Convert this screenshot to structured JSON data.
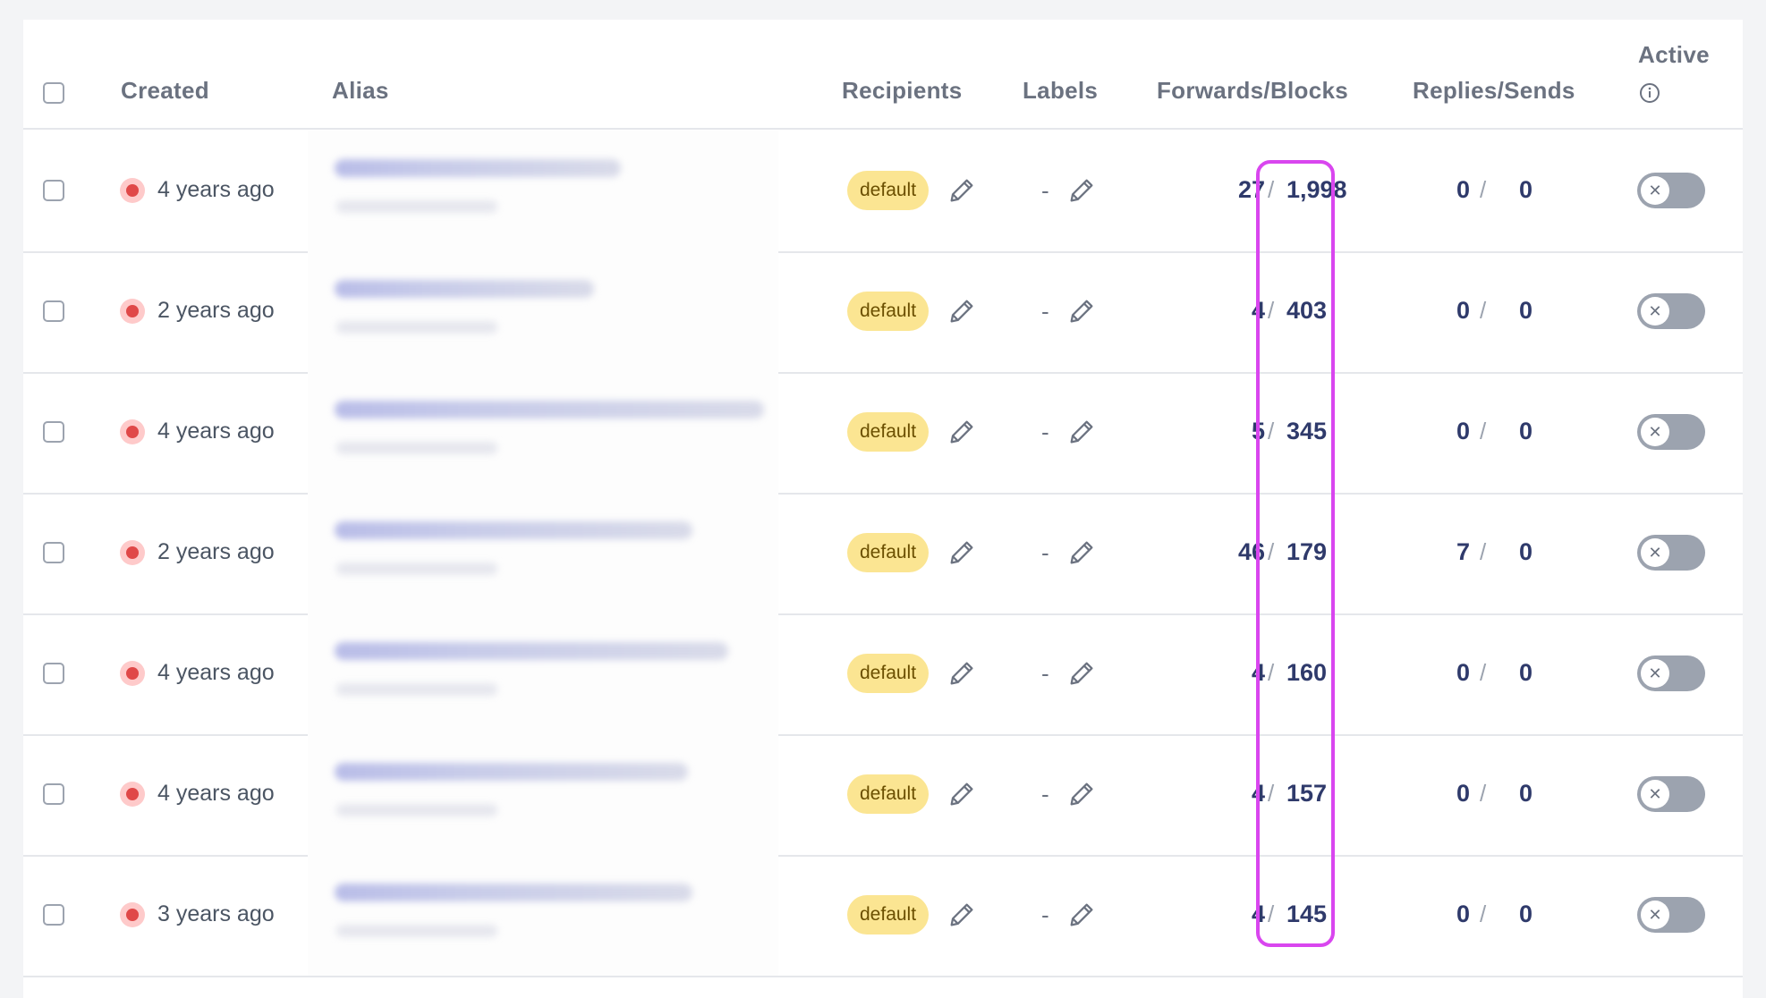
{
  "table": {
    "headers": {
      "created": "Created",
      "alias": "Alias",
      "recipients": "Recipients",
      "labels": "Labels",
      "forwards_blocks": "Forwards/Blocks",
      "replies_sends": "Replies/Sends",
      "active": "Active"
    },
    "rows": [
      {
        "created": "4 years ago",
        "recipient": "default",
        "labels": "-",
        "forwards": "27",
        "blocks": "1,998",
        "replies": "0",
        "sends": "0"
      },
      {
        "created": "2 years ago",
        "recipient": "default",
        "labels": "-",
        "forwards": "4",
        "blocks": "403",
        "replies": "0",
        "sends": "0"
      },
      {
        "created": "4 years ago",
        "recipient": "default",
        "labels": "-",
        "forwards": "5",
        "blocks": "345",
        "replies": "0",
        "sends": "0"
      },
      {
        "created": "2 years ago",
        "recipient": "default",
        "labels": "-",
        "forwards": "46",
        "blocks": "179",
        "replies": "7",
        "sends": "0"
      },
      {
        "created": "4 years ago",
        "recipient": "default",
        "labels": "-",
        "forwards": "4",
        "blocks": "160",
        "replies": "0",
        "sends": "0"
      },
      {
        "created": "4 years ago",
        "recipient": "default",
        "labels": "-",
        "forwards": "4",
        "blocks": "157",
        "replies": "0",
        "sends": "0"
      },
      {
        "created": "3 years ago",
        "recipient": "default",
        "labels": "-",
        "forwards": "4",
        "blocks": "145",
        "replies": "0",
        "sends": "0"
      }
    ]
  },
  "separators": {
    "slash": "/"
  },
  "icons": {
    "status": "inactive-dot-icon",
    "edit": "pencil-icon",
    "info": "info-circle-icon",
    "toggle": "toggle-off-icon"
  },
  "colors": {
    "highlight": "#d946ef",
    "badge_bg": "#fbe592",
    "status_dot": "#e04848",
    "count_text": "#2f3a6b",
    "toggle_off": "#9ca3af"
  }
}
